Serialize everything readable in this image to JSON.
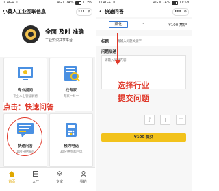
{
  "left": {
    "status": {
      "carrier": "Ill 4G+ .ıl",
      "net": "4G ıl",
      "battery": "74%",
      "time": "11:59"
    },
    "title": "小黄人工业互联信息",
    "capsule": {
      "more": "•••",
      "close": "⊙"
    },
    "banner": {
      "slogan": "全面 及时 准确",
      "subslogan": "工业知识共享平台"
    },
    "cards": [
      {
        "title": "专业提问",
        "desc": "专业人士答疑解惑"
      },
      {
        "title": "找专家",
        "desc": "专家一对一"
      },
      {
        "title": "快速问答",
        "desc": "100分钟解答"
      },
      {
        "title": "预约电话",
        "desc": "30分钟专家回电"
      }
    ],
    "annotation": "点击：快速问答",
    "tabs": [
      {
        "label": "首页",
        "color": "#e0a800"
      },
      {
        "label": "大厅",
        "color": "#555555"
      },
      {
        "label": "专家",
        "color": "#555555"
      },
      {
        "label": "我的",
        "color": "#555555"
      }
    ]
  },
  "right": {
    "status": {
      "carrier": "Ill 4G+ .ıl",
      "net": "4G ıl",
      "battery": "74%",
      "time": "11:59"
    },
    "title": "快速问答",
    "capsule": {
      "more": "•••",
      "close": "⊙"
    },
    "industry": "燕化",
    "price": "¥100 焦炉",
    "title_label": "标题",
    "title_placeholder": "请输入问题关键字",
    "desc_label": "问题描述",
    "desc_placeholder": "请输入问题内容",
    "attach": {
      "voice": "♪",
      "add": "+",
      "photo": "◫"
    },
    "annotation": [
      "选择行业",
      "提交问题"
    ],
    "submit": "¥100 提交"
  },
  "colors": {
    "accent_red": "#e0392b",
    "accent_yellow": "#f2c21b",
    "chip_blue": "#3a7bd5"
  }
}
